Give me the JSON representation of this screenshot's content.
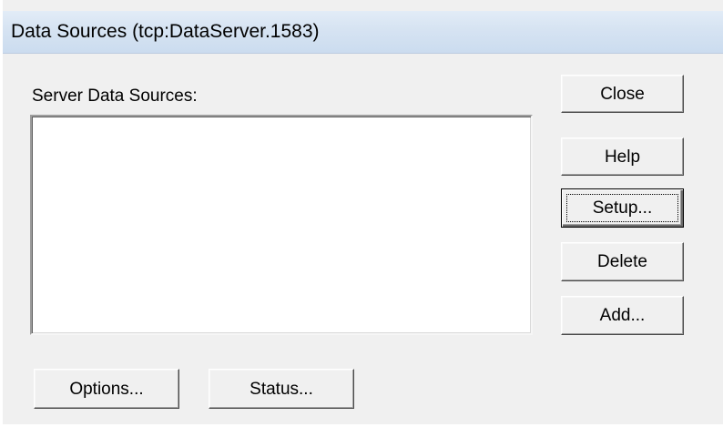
{
  "window": {
    "title": "Data Sources (tcp:DataServer.1583)"
  },
  "main": {
    "list_label": "Server Data Sources:",
    "list_items": []
  },
  "buttons": {
    "close": "Close",
    "help": "Help",
    "setup": "Setup...",
    "delete": "Delete",
    "add": "Add...",
    "options": "Options...",
    "status": "Status..."
  },
  "colors": {
    "dialog_background": "#f0f0f0",
    "titlebar_background": "#d6e3f2",
    "listbox_background": "#ffffff"
  }
}
